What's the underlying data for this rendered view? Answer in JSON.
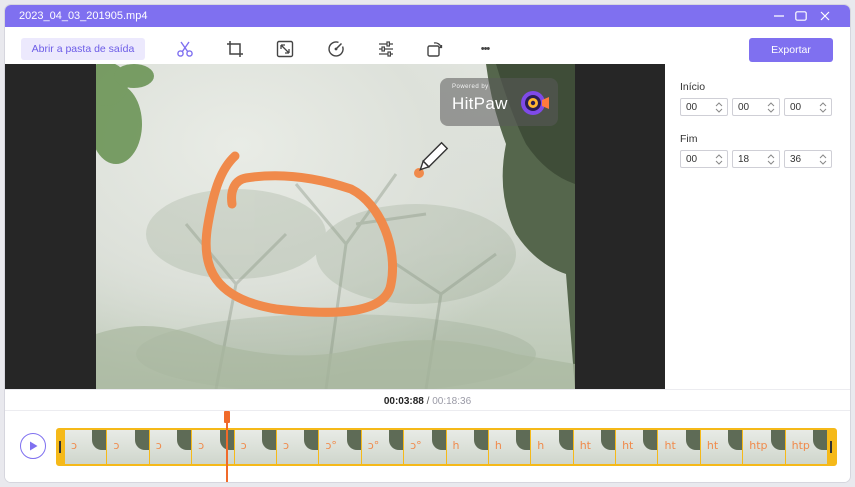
{
  "window": {
    "title": "2023_04_03_201905.mp4"
  },
  "toolbar": {
    "open_folder_label": "Abrir a pasta de saída",
    "export_label": "Exportar",
    "tools": [
      "scissors-icon",
      "crop-icon",
      "resize-icon",
      "speed-icon",
      "adjust-icon",
      "rotate-icon",
      "more-icon"
    ],
    "more_label": "•••"
  },
  "preview": {
    "watermark_top": "Powered by",
    "watermark_brand": "HitPaw"
  },
  "side": {
    "start_label": "Início",
    "start": [
      "00",
      "00",
      "00"
    ],
    "end_label": "Fim",
    "end": [
      "00",
      "18",
      "36"
    ]
  },
  "playback": {
    "current_time": "00:03:88",
    "separator": "/",
    "total_time": "00:18:36"
  },
  "timeline": {
    "thumbs": [
      "ↄ",
      "ↄ",
      "ↄ",
      "ↄ",
      "ↄ",
      "ↄ",
      "ↄ°",
      "ↄ°",
      "ↄ°",
      "h",
      "h",
      "h",
      "ht",
      "ht",
      "ht",
      "ht",
      "htp",
      "htp"
    ]
  },
  "colors": {
    "accent": "#7f70f0",
    "trim": "#f5b919",
    "playhead": "#f06a2a",
    "sketch": "#f08a4b"
  }
}
